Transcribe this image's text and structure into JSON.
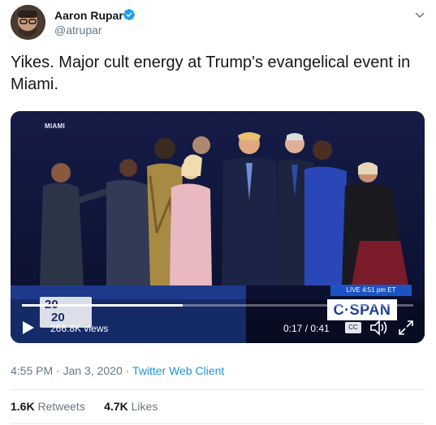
{
  "tweet": {
    "author_name": "Aaron Rupar",
    "author_handle": "@atrupar",
    "text": "Yikes. Major cult energy at Trump's evangelical event in Miami.",
    "timestamp": "4:55 PM · Jan 3, 2020 · ",
    "client": "Twitter Web Client",
    "retweets_count": "1.6K",
    "retweets_label": " Retweets",
    "likes_count": "4.7K",
    "likes_label": " Likes"
  },
  "video": {
    "location_label": "MIAMI",
    "live_label": "LIVE  4:51 pm ET",
    "network_label": "C·SPAN",
    "logo_top": "20",
    "logo_bottom": "20",
    "views": "266.8K views",
    "time": "0:17 / 0:41",
    "cc_label": "CC",
    "progress_fraction": 0.41
  },
  "icons": {
    "verified": "verified-badge-icon",
    "caret": "chevron-down-icon",
    "play": "play-icon",
    "volume": "volume-icon",
    "fullscreen": "fullscreen-icon"
  },
  "colors": {
    "verified_blue": "#1da1f2",
    "link_blue": "#1b95e0",
    "secondary_text": "#657786",
    "cspan_blue": "#1c53c4"
  }
}
